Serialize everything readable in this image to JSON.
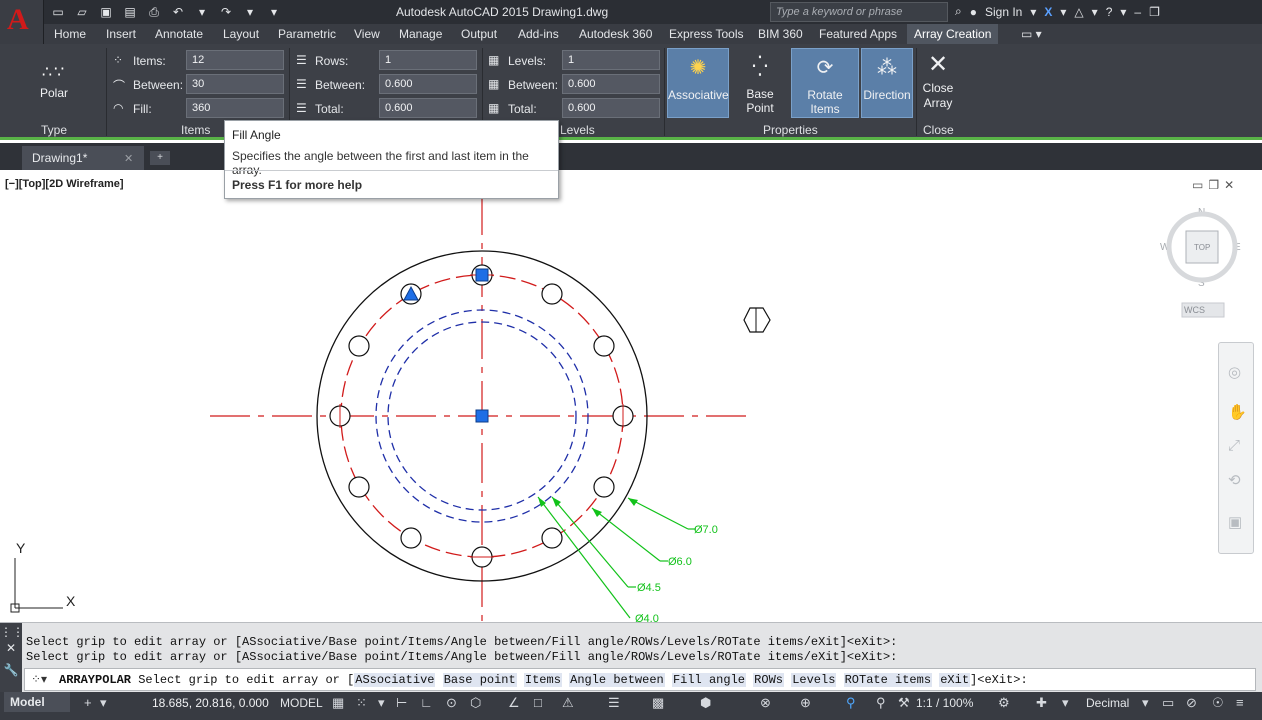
{
  "app": {
    "logo_letter": "A",
    "title": "Autodesk AutoCAD 2015    Drawing1.dwg",
    "search_placeholder": "Type a keyword or phrase",
    "sign_in": "Sign In"
  },
  "ribbon_tabs": [
    "Home",
    "Insert",
    "Annotate",
    "Layout",
    "Parametric",
    "View",
    "Manage",
    "Output",
    "Add-ins",
    "Autodesk 360",
    "Express Tools",
    "BIM 360",
    "Featured Apps",
    "Array Creation"
  ],
  "ribbon": {
    "type_button": "Polar",
    "panels": {
      "type": "Type",
      "items": "Items",
      "levels": "Levels",
      "properties": "Properties",
      "close": "Close"
    },
    "items": {
      "items_label": "Items:",
      "items_value": "12",
      "between_label": "Between:",
      "between_value": "30",
      "fill_label": "Fill:",
      "fill_value": "360"
    },
    "rows": {
      "rows_label": "Rows:",
      "rows_value": "1",
      "between_label": "Between:",
      "between_value": "0.600",
      "total_label": "Total:",
      "total_value": "0.600"
    },
    "levels": {
      "levels_label": "Levels:",
      "levels_value": "1",
      "between_label": "Between:",
      "between_value": "0.600",
      "total_label": "Total:",
      "total_value": "0.600"
    },
    "properties": {
      "associative": "Associative",
      "base_point": "Base Point",
      "rotate_items": "Rotate Items",
      "direction": "Direction"
    },
    "close_array": "Close\nArray"
  },
  "doc_tab": "Drawing1*",
  "tooltip": {
    "title": "Fill Angle",
    "description": "Specifies the angle between the first and last item in the array.",
    "help": "Press F1 for more help"
  },
  "viewport_label": "[−][Top][2D Wireframe]",
  "viewcube": {
    "n": "N",
    "s": "S",
    "e": "E",
    "w": "W",
    "top": "TOP",
    "wcs": "WCS"
  },
  "dimensions": [
    "Ø7.0",
    "Ø6.0",
    "Ø4.5",
    "Ø4.0"
  ],
  "ucs": {
    "x": "X",
    "y": "Y"
  },
  "command": {
    "history": [
      "Select grip to edit array or [ASsociative/Base point/Items/Angle between/Fill angle/ROWs/Levels/ROTate items/eXit]<eXit>:",
      "Select grip to edit array or [ASsociative/Base point/Items/Angle between/Fill angle/ROWs/Levels/ROTate items/eXit]<eXit>:"
    ],
    "prompt_cmd": "ARRAYPOLAR",
    "prompt_text": "Select grip to edit array or [",
    "options": [
      "ASsociative",
      "Base point",
      "Items",
      "Angle between",
      "Fill angle",
      "ROWs",
      "Levels",
      "ROTate items",
      "eXit"
    ],
    "prompt_end": "]<eXit>:"
  },
  "status": {
    "model_tab": "Model",
    "coords": "18.685, 20.816, 0.000",
    "model": "MODEL",
    "scale": "1:1 / 100%",
    "units": "Decimal"
  }
}
